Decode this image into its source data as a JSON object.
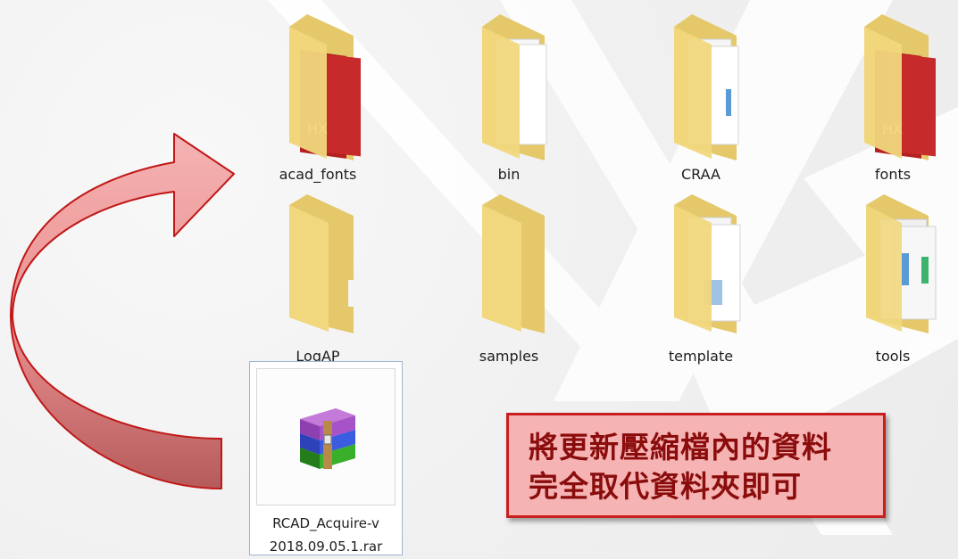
{
  "folders": [
    {
      "name": "acad_fonts",
      "icon": "folder-with-font-files-icon"
    },
    {
      "name": "bin",
      "icon": "folder-with-documents-icon"
    },
    {
      "name": "CRAA",
      "icon": "folder-with-documents-icon"
    },
    {
      "name": "fonts",
      "icon": "folder-with-font-files-icon"
    },
    {
      "name": "LogAP",
      "icon": "empty-folder-icon"
    },
    {
      "name": "samples",
      "icon": "empty-folder-icon"
    },
    {
      "name": "template",
      "icon": "folder-with-documents-icon"
    },
    {
      "name": "tools",
      "icon": "folder-with-documents-icon"
    }
  ],
  "file": {
    "name_line1": "RCAD_Acquire-v",
    "name_line2": "2018.09.05.1.rar",
    "icon": "winrar-archive-icon"
  },
  "note": {
    "line1": "將更新壓縮檔內的資料",
    "line2": "完全取代資料夾即可"
  },
  "colors": {
    "note_fill": "#f6b3b3",
    "note_border": "#c81e1e",
    "note_text": "#8a0c0c",
    "arrow_fill": "#f2a1a1",
    "arrow_stroke": "#c01818",
    "selection_border": "#9fb6cf"
  }
}
